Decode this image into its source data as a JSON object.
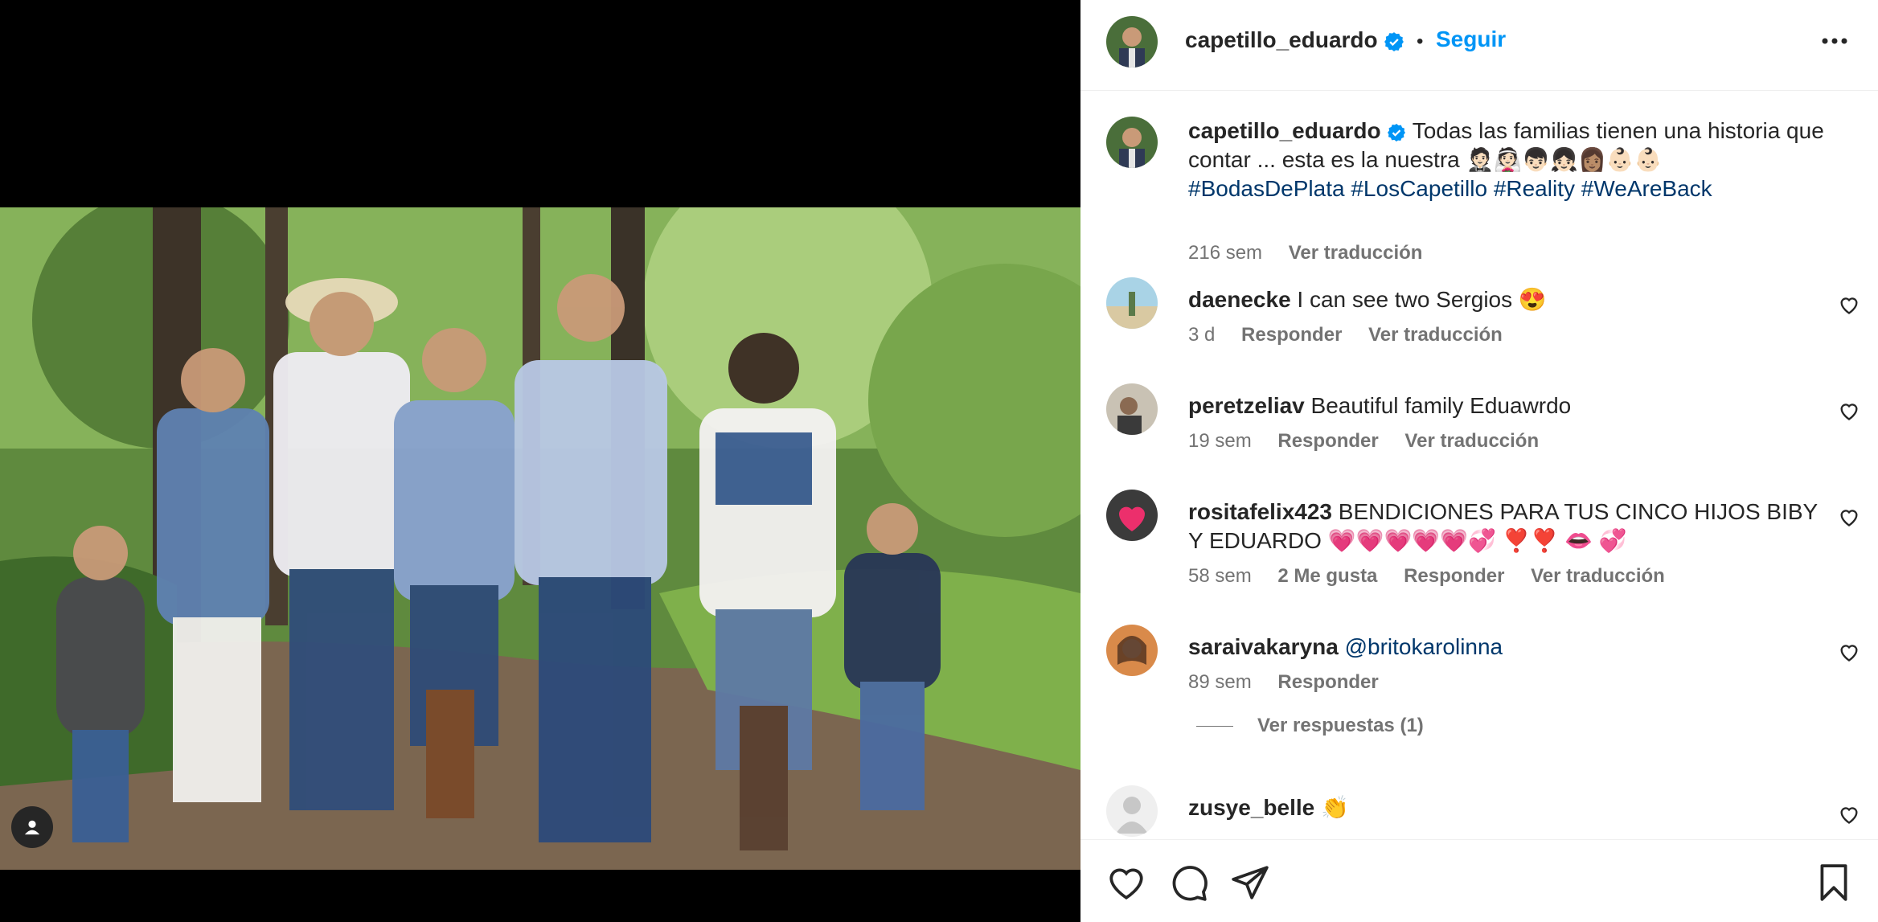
{
  "post": {
    "username": "capetillo_eduardo",
    "follow_label": "Seguir",
    "separator": "•"
  },
  "caption": {
    "username": "capetillo_eduardo",
    "text": "Todas las familias tienen una historia que contar ... esta es la nuestra 🤵🏻👰🏻👦🏻👧🏻👩🏽👶🏻👶🏻",
    "hashtags": [
      "#BodasDePlata",
      "#LosCapetillo",
      "#Reality",
      "#WeAreBack"
    ],
    "time": "216 sem",
    "translate": "Ver traducción"
  },
  "comments": [
    {
      "username": "daenecke",
      "text": "I can see two Sergios 😍",
      "time": "3 d",
      "likes": "",
      "reply": "Responder",
      "translate": "Ver traducción"
    },
    {
      "username": "peretzeliav",
      "text": "Beautiful family Eduawrdo",
      "time": "19 sem",
      "likes": "",
      "reply": "Responder",
      "translate": "Ver traducción"
    },
    {
      "username": "rositafelix423",
      "text": "BENDICIONES PARA TUS CINCO HIJOS BIBY Y EDUARDO 💗💗💗💗💗💞 ❣️❣️ 👄 💞",
      "time": "58 sem",
      "likes": "2 Me gusta",
      "reply": "Responder",
      "translate": "Ver traducción"
    },
    {
      "username": "saraivakaryna",
      "text": "@britokarolinna",
      "time": "89 sem",
      "likes": "",
      "reply": "Responder",
      "translate": ""
    },
    {
      "username": "zusye_belle",
      "text": "👏",
      "time": "",
      "likes": "",
      "reply": "",
      "translate": ""
    }
  ],
  "view_replies": "Ver respuestas (1)",
  "colors": {
    "accent": "#0095f6",
    "link": "#00376b",
    "muted": "#737373",
    "text": "#262626"
  }
}
